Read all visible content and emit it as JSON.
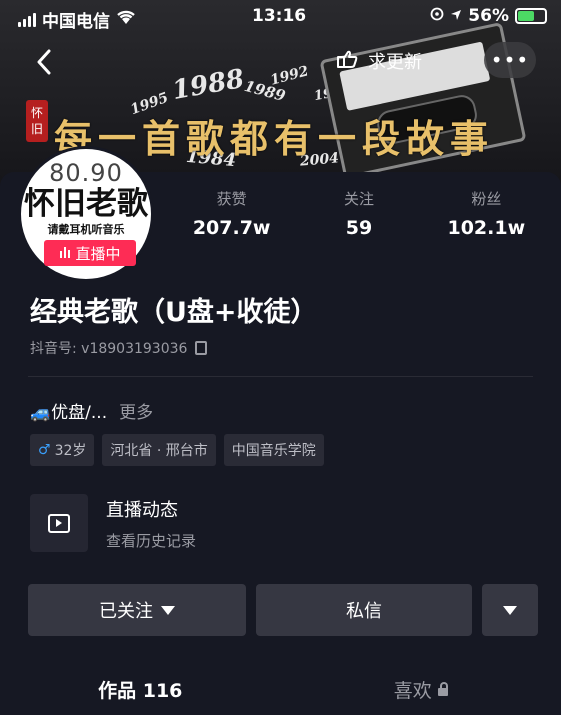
{
  "status_bar": {
    "carrier": "中国电信",
    "time": "13:16",
    "battery": "56%"
  },
  "nav": {
    "update_label": "求更新",
    "more_label": "•••"
  },
  "banner": {
    "title": "每一首歌都有一段故事",
    "seal": "怀旧",
    "years": [
      "1995",
      "1988",
      "1989",
      "1992",
      "1999",
      "1984",
      "2004"
    ]
  },
  "avatar": {
    "number": "80.90",
    "main": "怀旧老歌",
    "sub": "请戴耳机听音乐"
  },
  "live_badge": "直播中",
  "stats": [
    {
      "label": "获赞",
      "value": "207.7w"
    },
    {
      "label": "关注",
      "value": "59"
    },
    {
      "label": "粉丝",
      "value": "102.1w"
    }
  ],
  "profile": {
    "nickname": "经典老歌（U盘+收徒）",
    "douyin_id": "抖音号: v18903193036",
    "bio": "🚙优盘/...",
    "bio_more": "更多"
  },
  "tags": {
    "gender_age": "32岁",
    "location": "河北省 · 邢台市",
    "school": "中国音乐学院"
  },
  "live_dynamic": {
    "title": "直播动态",
    "subtitle": "查看历史记录"
  },
  "buttons": {
    "follow": "已关注",
    "message": "私信"
  },
  "tabs": {
    "works": "作品 116",
    "likes": "喜欢"
  },
  "colors": {
    "background": "#161823",
    "accent": "#fe2c55",
    "button": "#363742"
  }
}
